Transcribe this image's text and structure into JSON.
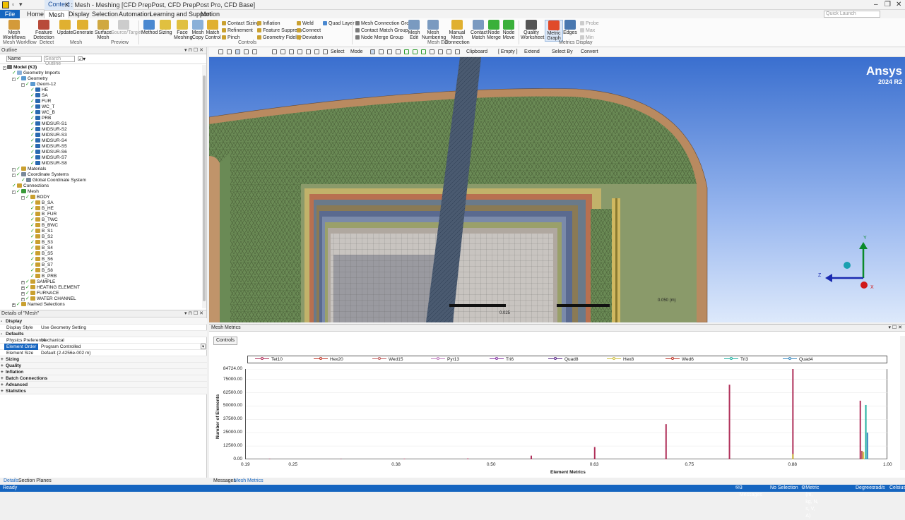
{
  "window": {
    "title": "K : Mesh - Meshing [CFD PrepPost, CFD PrepPost Pro, CFD Base]",
    "context_tab": "Context",
    "quick_launch_placeholder": "Quick Launch"
  },
  "ribbon_tabs": [
    "File",
    "Home",
    "Mesh",
    "Display",
    "Selection",
    "Automation",
    "Learning and Support",
    "Motion"
  ],
  "ribbon": {
    "mesh_workflows": "Mesh Workflows",
    "feature_detection": "Feature Detection",
    "update": "Update",
    "generate": "Generate",
    "surface_mesh": "Surface Mesh",
    "source_target": "Source/Target",
    "method": "Method",
    "sizing": "Sizing",
    "face_meshing": "Face Meshing",
    "mesh_copy": "Mesh Copy",
    "match_control": "Match Control",
    "contact_sizing": "Contact Sizing",
    "refinement": "Refinement",
    "pinch": "Pinch",
    "inflation": "Inflation",
    "feature_suppress": "Feature Suppress",
    "geometry_fidelity": "Geometry Fidelity",
    "weld": "Weld",
    "connect": "Connect",
    "deviation": "Deviation",
    "quad_layer": "Quad Layer",
    "mesh_connection_group": "Mesh Connection Group",
    "contact_match_group": "Contact Match Group",
    "node_merge_group": "Node Merge Group",
    "mesh_edit": "Mesh Edit",
    "mesh_numbering": "Mesh Numbering",
    "manual_mesh_connection": "Manual Mesh Connection",
    "contact_match": "Contact Match",
    "node_merge": "Node Merge",
    "node_move": "Node Move",
    "quality_worksheet": "Quality Worksheet",
    "metric_graph": "Metric Graph",
    "edges": "Edges",
    "probe": "Probe",
    "max": "Max",
    "min": "Min",
    "groups": {
      "mesh_workflow": "Mesh Workflow",
      "detect": "Detect",
      "mesh": "Mesh",
      "preview": "Preview",
      "controls": "Controls",
      "mesh_edit": "Mesh Edit",
      "metrics_display": "Metrics Display"
    }
  },
  "outline": {
    "header": "Outline",
    "filter_select": "Name",
    "search_placeholder": "Search Outline",
    "items": [
      "Model (K3)",
      "Geometry Imports",
      "Geometry",
      "Geom-12",
      "HE",
      "SA",
      "FUR",
      "WC_T",
      "WC_B",
      "PRB",
      "MIDSUR-S1",
      "MIDSUR-S2",
      "MIDSUR-S3",
      "MIDSUR-S4",
      "MIDSUR-S5",
      "MIDSUR-S6",
      "MIDSUR-S7",
      "MIDSUR-S8",
      "Materials",
      "Coordinate Systems",
      "Global Coordinate System",
      "Connections",
      "Mesh",
      "BODY",
      "B_SA",
      "B_HE",
      "B_FUR",
      "B_TWC",
      "B_BWC",
      "B_S1",
      "B_S2",
      "B_S3",
      "B_S4",
      "B_S5",
      "B_S6",
      "B_S7",
      "B_S8",
      "B_PRB",
      "SAMPLE",
      "HEATING ELEMENT",
      "FURNACE",
      "WATER CHANNEL",
      "Named Selections"
    ]
  },
  "details": {
    "header": "Details of \"Mesh\"",
    "rows": [
      {
        "k": "Display",
        "v": "",
        "cat": true
      },
      {
        "k": "Display Style",
        "v": "Use Geometry Setting"
      },
      {
        "k": "Defaults",
        "v": "",
        "cat": true
      },
      {
        "k": "Physics Preference",
        "v": "Mechanical"
      },
      {
        "k": "Element Order",
        "v": "Program Controlled",
        "sel": true
      },
      {
        "k": "Element Size",
        "v": "Default (2.4256e-002 m)"
      },
      {
        "k": "Sizing",
        "v": "",
        "cat": true,
        "plus": true
      },
      {
        "k": "Quality",
        "v": "",
        "cat": true,
        "plus": true
      },
      {
        "k": "Inflation",
        "v": "",
        "cat": true,
        "plus": true
      },
      {
        "k": "Batch Connections",
        "v": "",
        "cat": true,
        "plus": true
      },
      {
        "k": "Advanced",
        "v": "",
        "cat": true,
        "plus": true
      },
      {
        "k": "Statistics",
        "v": "",
        "cat": true,
        "plus": true
      }
    ]
  },
  "left_bottom_tabs": [
    "Details",
    "Section Planes"
  ],
  "view_toolbar": {
    "select": "Select",
    "mode": "Mode",
    "clipboard": "Clipboard",
    "empty": "[ Empty ]",
    "extend": "Extend",
    "select_by": "Select By",
    "convert": "Convert"
  },
  "viewport": {
    "brand": "Ansys",
    "version": "2024 R2",
    "scale_labels": [
      "0.025",
      "0.050 (m)"
    ],
    "axes": [
      "Y",
      "Z",
      "X"
    ]
  },
  "metrics": {
    "header": "Mesh Metrics",
    "controls_button": "Controls",
    "xlabel": "Element Metrics",
    "ylabel": "Number of Elements"
  },
  "chart_data": {
    "type": "bar",
    "legend": [
      {
        "name": "Tet10",
        "color": "#b0305a"
      },
      {
        "name": "Hex20",
        "color": "#c0392b"
      },
      {
        "name": "Wed15",
        "color": "#c06060"
      },
      {
        "name": "Pyr13",
        "color": "#c080c0"
      },
      {
        "name": "Tri6",
        "color": "#8a3aa8"
      },
      {
        "name": "Quad8",
        "color": "#5a2a8a"
      },
      {
        "name": "Hex8",
        "color": "#d0c040"
      },
      {
        "name": "Wed6",
        "color": "#c0392b"
      },
      {
        "name": "Tri3",
        "color": "#20b0a0"
      },
      {
        "name": "Quad4",
        "color": "#3a8ac0"
      }
    ],
    "xlim": [
      0.19,
      1.0
    ],
    "x_ticks": [
      "0.19",
      "0.25",
      "0.38",
      "0.50",
      "0.63",
      "0.75",
      "0.88",
      "1.00"
    ],
    "x_tick_values": [
      0.19,
      0.25,
      0.38,
      0.5,
      0.63,
      0.75,
      0.88,
      1.0
    ],
    "ylim": [
      0,
      84724
    ],
    "y_ticks": [
      "84724.00",
      "75000.00",
      "62500.00",
      "50000.00",
      "37500.00",
      "25000.00",
      "12500.00",
      "0.00"
    ],
    "y_tick_values": [
      84724,
      75000,
      62500,
      50000,
      37500,
      25000,
      12500,
      0
    ],
    "bars": [
      {
        "x": 0.22,
        "y": 400,
        "color": "#b0305a"
      },
      {
        "x": 0.31,
        "y": 300,
        "color": "#b0305a"
      },
      {
        "x": 0.39,
        "y": 500,
        "color": "#b0305a"
      },
      {
        "x": 0.47,
        "y": 800,
        "color": "#b0305a"
      },
      {
        "x": 0.55,
        "y": 3500,
        "color": "#b0305a"
      },
      {
        "x": 0.63,
        "y": 11500,
        "color": "#b0305a"
      },
      {
        "x": 0.72,
        "y": 33000,
        "color": "#b0305a"
      },
      {
        "x": 0.8,
        "y": 70000,
        "color": "#b0305a"
      },
      {
        "x": 0.88,
        "y": 84724,
        "color": "#b0305a"
      },
      {
        "x": 0.88,
        "y": 5000,
        "color": "#d0c040"
      },
      {
        "x": 0.965,
        "y": 55000,
        "color": "#b0305a"
      },
      {
        "x": 0.967,
        "y": 8000,
        "color": "#c06060"
      },
      {
        "x": 0.969,
        "y": 7000,
        "color": "#d0c040"
      },
      {
        "x": 0.972,
        "y": 51000,
        "color": "#20b0a0"
      },
      {
        "x": 0.974,
        "y": 25000,
        "color": "#3a8ac0"
      }
    ]
  },
  "right_bottom_tabs": [
    "Messages",
    "Mesh Metrics"
  ],
  "status": {
    "ready": "Ready",
    "messages": "3 Messages",
    "selection": "No Selection",
    "units": "Metric (m, kg, N, s, V, A)",
    "angle": "Degrees",
    "rate": "rad/s",
    "temp": "Celsius"
  }
}
